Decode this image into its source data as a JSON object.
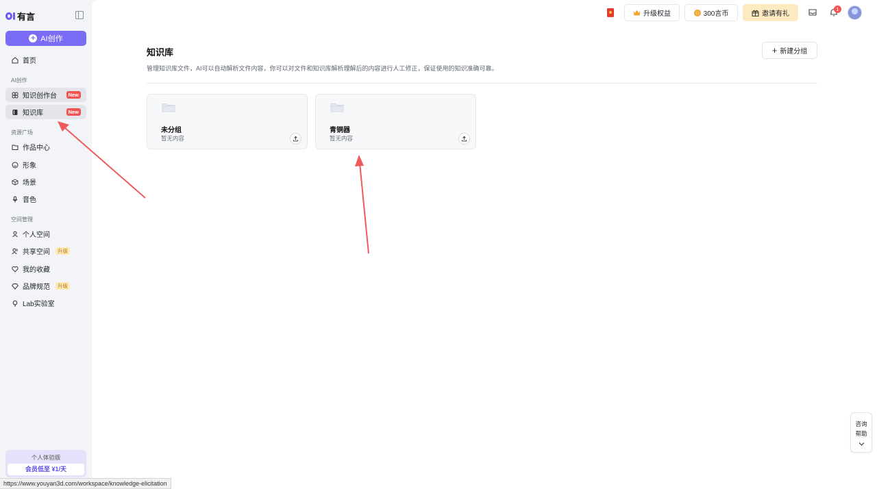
{
  "brand": {
    "name": "有言"
  },
  "sidebar": {
    "ai_button": "AI创作",
    "home": "首页",
    "section_ai": "AI创作",
    "items_ai": [
      {
        "label": "知识创作台",
        "badge": "New"
      },
      {
        "label": "知识库",
        "badge": "New"
      }
    ],
    "section_resources": "资源广场",
    "items_resources": [
      {
        "label": "作品中心"
      },
      {
        "label": "形象"
      },
      {
        "label": "场景"
      },
      {
        "label": "音色"
      }
    ],
    "section_space": "空间管理",
    "items_space": [
      {
        "label": "个人空间"
      },
      {
        "label": "共享空间",
        "badge": "升级"
      },
      {
        "label": "我的收藏"
      },
      {
        "label": "品牌规范",
        "badge": "升级"
      },
      {
        "label": "Lab实验室"
      }
    ],
    "promo": {
      "title": "个人体验版",
      "button": "会员低至 ¥1/天"
    }
  },
  "topbar": {
    "upgrade": "升级权益",
    "coins": "300言币",
    "invite": "邀请有礼",
    "notification_count": "1"
  },
  "page": {
    "title": "知识库",
    "description": "管理知识库文件，AI可以自动解析文件内容，你可以对文件和知识库解析理解后的内容进行人工修正，保证使用的知识准确可靠。",
    "new_group_button": "新建分组",
    "groups": [
      {
        "name": "未分组",
        "status": "暂无内容"
      },
      {
        "name": "青铜器",
        "status": "暂无内容"
      }
    ]
  },
  "help_widget": {
    "line1": "咨询",
    "line2": "帮助"
  },
  "status_bar": {
    "url": "https://www.youyan3d.com/workspace/knowledge-elicitation"
  },
  "colors": {
    "accent": "#7b6cf6",
    "new_badge": "#f25353",
    "annotation_arrow": "#f05a5a"
  }
}
